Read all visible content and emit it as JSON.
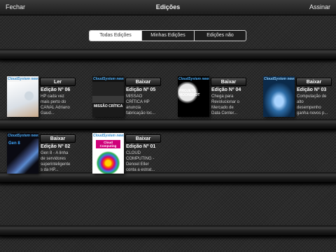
{
  "topbar": {
    "left": "Fechar",
    "title": "Edições",
    "right": "Assinar"
  },
  "tabs": [
    "Todas Edições",
    "Minhas Edições",
    "Edições não Adquiridas"
  ],
  "issues": [
    {
      "button": "Ler",
      "title": "Edição Nº 06",
      "desc": "HP cada vez mais perto do CANAL Adriano Gaud...",
      "masthead": "CloudSystem news"
    },
    {
      "button": "Baixar",
      "title": "Edição Nº 05",
      "desc": "MISSÃO CRÍTICA HP anuncia fabricação loc...",
      "masthead": "CloudSystem news",
      "cover_text": "MISSÃO CRÍTICA"
    },
    {
      "button": "Baixar",
      "title": "Edição Nº 04",
      "desc": "Chega para Revolucionar o Mercado de Data Center...",
      "masthead": "CloudSystem news",
      "cover_text": "PROJETO MOONSHOT"
    },
    {
      "button": "Baixar",
      "title": "Edição Nº 03",
      "desc": "Computação de alto desempenho ganha novos p...",
      "masthead": "CloudSystem news"
    },
    {
      "button": "Baixar",
      "title": "Edição Nº 02",
      "desc": "Gen 8 - A linha de servidores superinteligente s da HP...",
      "masthead": "CloudSystem news",
      "cover_text": "Gen 8"
    },
    {
      "button": "Baixar",
      "title": "Edição Nº 01",
      "desc": "CLOUD COMPUTING - Denoel Eller conta a estrat...",
      "masthead": "CloudSystem news",
      "cover_text": "Cloud Computing"
    }
  ]
}
